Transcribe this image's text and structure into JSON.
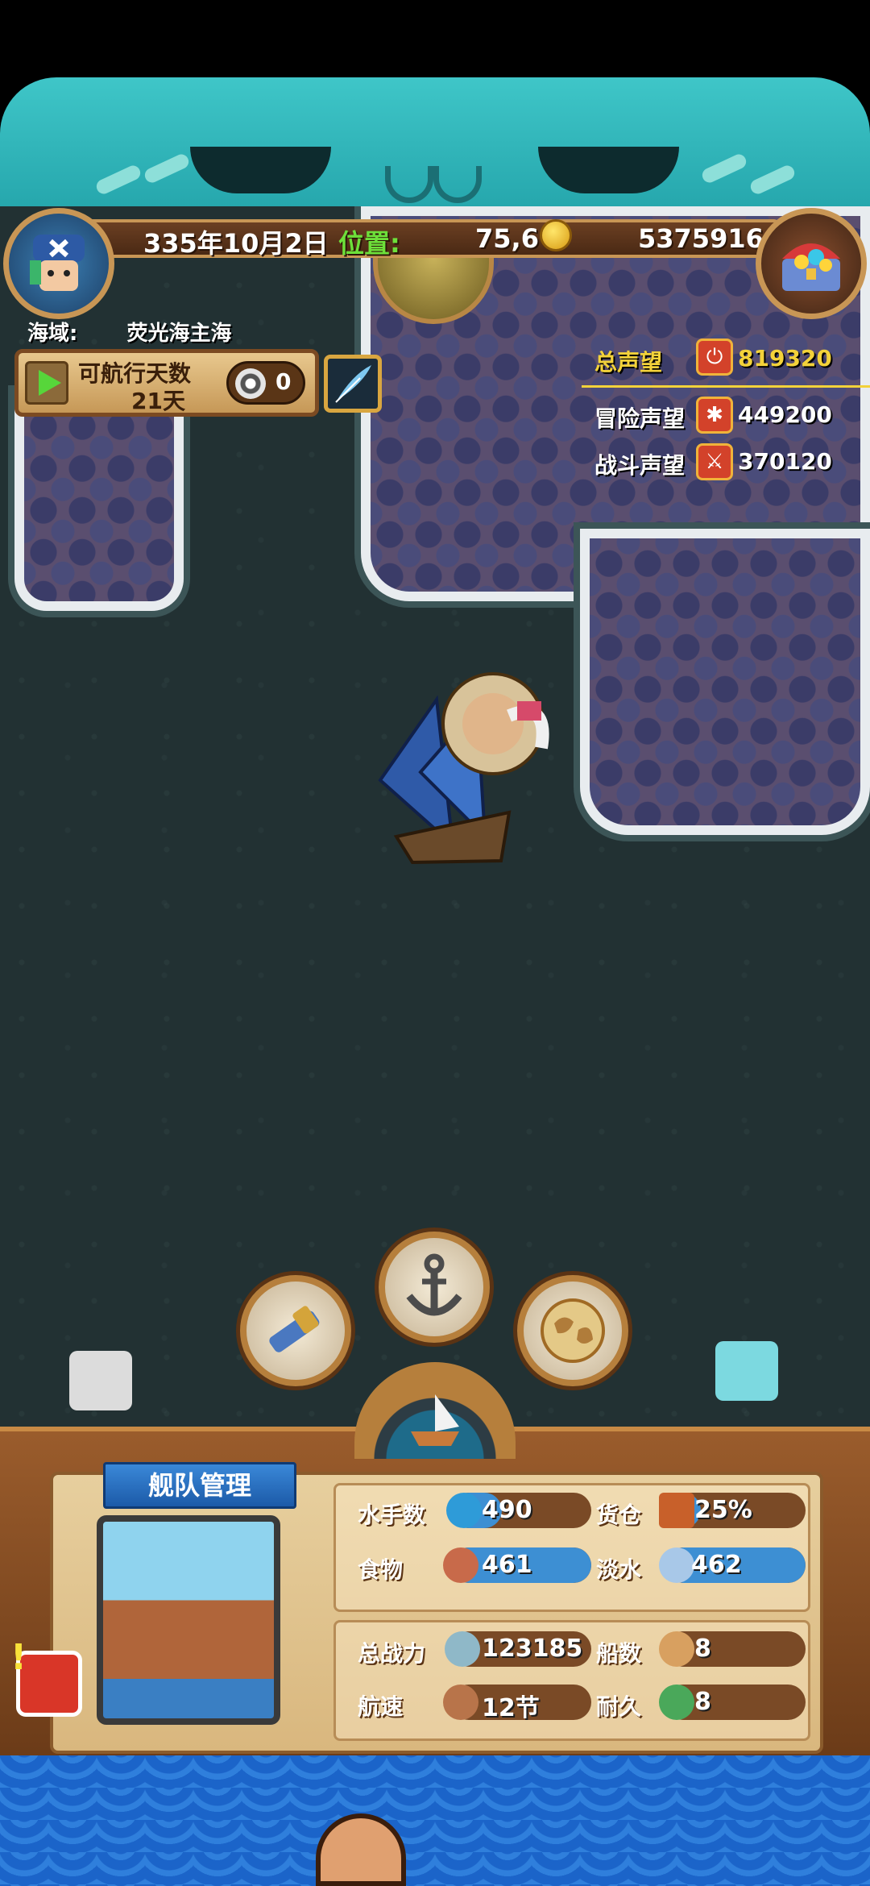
{
  "hud": {
    "date": "335年10月2日",
    "location_label": "位置:",
    "location_value": "75,6",
    "gold": "5375916"
  },
  "sea_area": {
    "label": "海域:",
    "name": "荧光海主海"
  },
  "sail": {
    "days_label": "可航行天数",
    "days_value": "21天",
    "token_count": "0"
  },
  "reputation": {
    "total_label": "总声望",
    "total_value": "819320",
    "adventure_label": "冒险声望",
    "adventure_value": "449200",
    "battle_label": "战斗声望",
    "battle_value": "370120"
  },
  "fleet": {
    "title": "舰队管理",
    "sailors_label": "水手数",
    "sailors_value": "490",
    "cargo_label": "货仓",
    "cargo_value": "25%",
    "cargo_fraction": 0.25,
    "food_label": "食物",
    "food_value": "461",
    "water_label": "淡水",
    "water_value": "462",
    "power_label": "总战力",
    "power_value": "123185",
    "ships_label": "船数",
    "ships_value": "8",
    "speed_label": "航速",
    "speed_value": "12节",
    "durability_label": "耐久",
    "durability_value": "8"
  },
  "colors": {
    "hud_gold": "#c89655",
    "sea": "#223133",
    "highlight_yellow": "#f3d23a",
    "location_green": "#6de03a",
    "bar_blue": "#3d8fd3"
  },
  "icons": {
    "telescope": "telescope-icon",
    "anchor": "anchor-icon",
    "map": "world-map-icon",
    "fleet": "ship-icon"
  }
}
